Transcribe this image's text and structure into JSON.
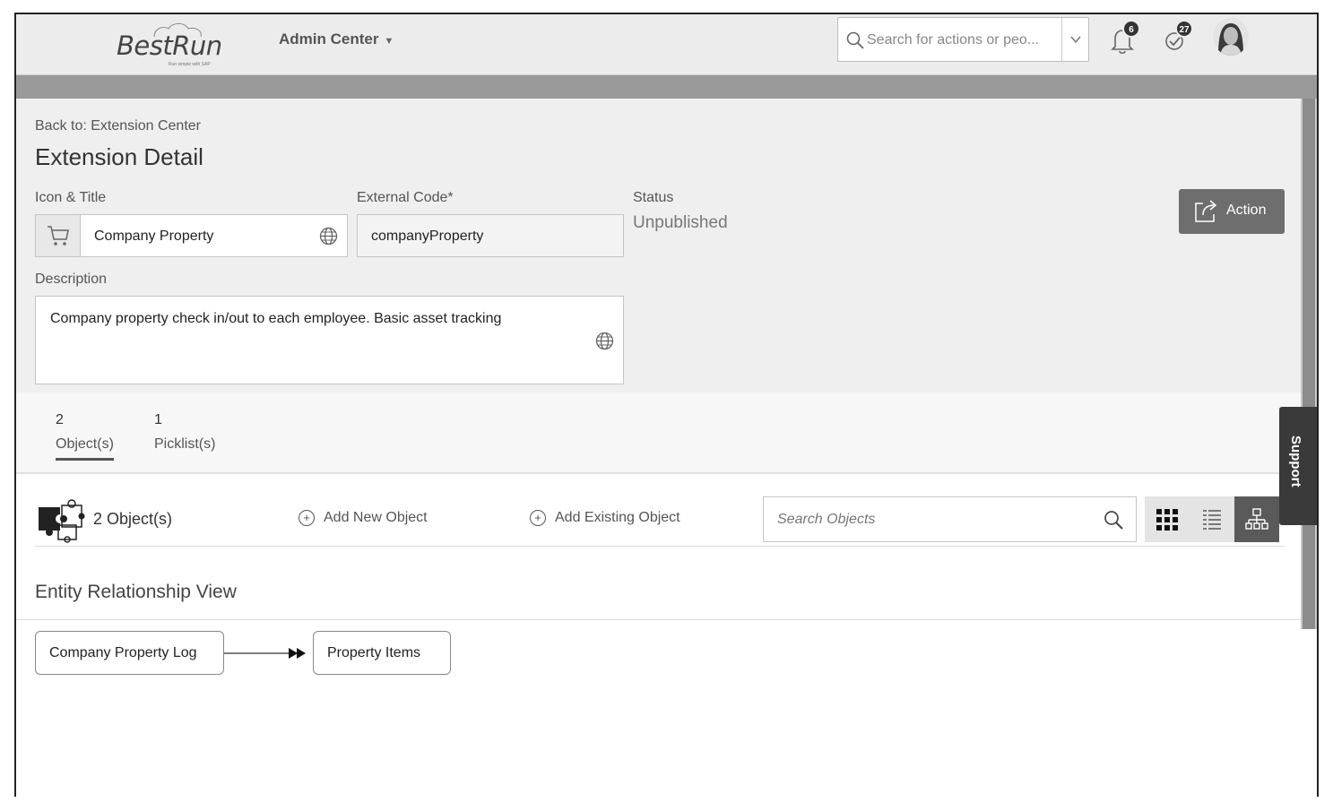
{
  "shell": {
    "logo_text": "BestRun",
    "logo_subtext": "Run simple with SAP",
    "app_menu": "Admin Center",
    "search_placeholder": "Search for actions or peo...",
    "notifications_count": "6",
    "todo_count": "27"
  },
  "header": {
    "back_link": "Back to: Extension Center",
    "title": "Extension Detail",
    "icon_title_label": "Icon & Title",
    "icon_title_value": "Company Property",
    "external_code_label": "External Code*",
    "external_code_value": "companyProperty",
    "status_label": "Status",
    "status_value": "Unpublished",
    "action_label": "Action",
    "description_label": "Description",
    "description_value": "Company property check in/out to each employee.  Basic asset tracking"
  },
  "tabs": [
    {
      "count": "2",
      "name": "Object(s)"
    },
    {
      "count": "1",
      "name": "Picklist(s)"
    }
  ],
  "objects_toolbar": {
    "count_label": "2 Object(s)",
    "add_new": "Add New Object",
    "add_existing": "Add Existing Object",
    "search_placeholder": "Search Objects"
  },
  "support_label": "Support",
  "er_view": {
    "title": "Entity Relationship View",
    "nodes": [
      "Company Property Log",
      "Property Items"
    ]
  }
}
